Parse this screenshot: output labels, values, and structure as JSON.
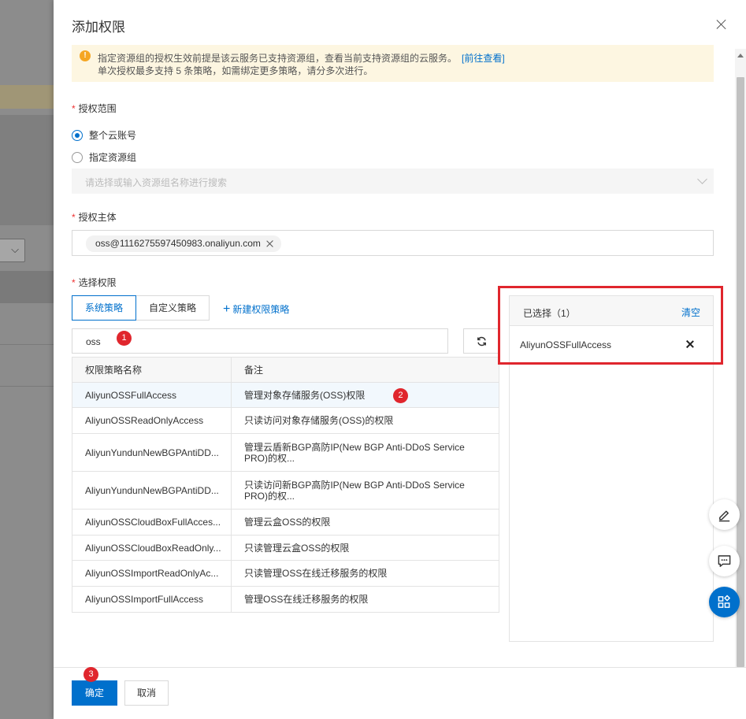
{
  "drawer": {
    "title": "添加权限",
    "notice": {
      "line1": "指定资源组的授权生效前提是该云服务已支持资源组，查看当前支持资源组的云服务。",
      "link": "[前往查看]",
      "line2": "单次授权最多支持 5 条策略，如需绑定更多策略，请分多次进行。"
    },
    "scope": {
      "label": "授权范围",
      "options": [
        {
          "label": "整个云账号",
          "selected": true
        },
        {
          "label": "指定资源组",
          "selected": false
        }
      ],
      "resource_group_placeholder": "请选择或输入资源组名称进行搜索"
    },
    "principal": {
      "label": "授权主体",
      "tag": "oss@1116275597450983.onaliyun.com"
    },
    "permissions": {
      "label": "选择权限",
      "tabs": [
        "系统策略",
        "自定义策略"
      ],
      "active_tab": "系统策略",
      "new_policy": "新建权限策略",
      "search_value": "oss",
      "table": {
        "headers": [
          "权限策略名称",
          "备注"
        ],
        "rows": [
          {
            "name": "AliyunOSSFullAccess",
            "note": "管理对象存储服务(OSS)权限"
          },
          {
            "name": "AliyunOSSReadOnlyAccess",
            "note": "只读访问对象存储服务(OSS)的权限"
          },
          {
            "name": "AliyunYundunNewBGPAntiDD...",
            "note": "管理云盾新BGP高防IP(New BGP Anti-DDoS Service PRO)的权..."
          },
          {
            "name": "AliyunYundunNewBGPAntiDD...",
            "note": "只读访问新BGP高防IP(New BGP Anti-DDoS Service PRO)的权..."
          },
          {
            "name": "AliyunOSSCloudBoxFullAcces...",
            "note": "管理云盒OSS的权限"
          },
          {
            "name": "AliyunOSSCloudBoxReadOnly...",
            "note": "只读管理云盒OSS的权限"
          },
          {
            "name": "AliyunOSSImportReadOnlyAc...",
            "note": "只读管理OSS在线迁移服务的权限"
          },
          {
            "name": "AliyunOSSImportFullAccess",
            "note": "管理OSS在线迁移服务的权限"
          }
        ]
      }
    },
    "selected": {
      "title": "已选择（1）",
      "clear": "清空",
      "items": [
        "AliyunOSSFullAccess"
      ]
    },
    "footer": {
      "ok": "确定",
      "cancel": "取消"
    },
    "annotations": [
      "1",
      "2",
      "3"
    ],
    "colors": {
      "primary": "#0070cc",
      "annotation_red": "#e0262d",
      "notice_bg": "#fdf6e1"
    }
  }
}
